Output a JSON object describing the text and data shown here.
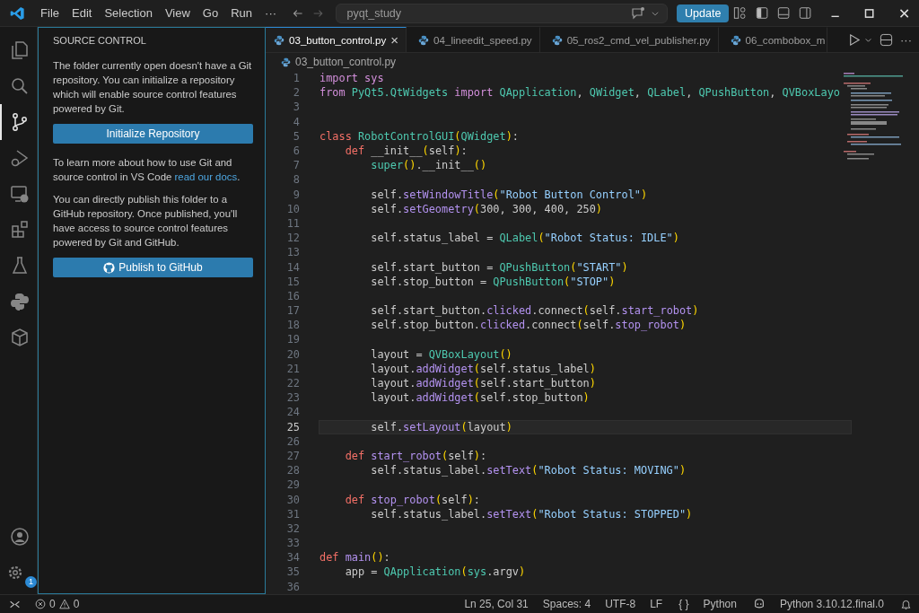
{
  "title_bar": {
    "menus": [
      "File",
      "Edit",
      "Selection",
      "View",
      "Go",
      "Run"
    ],
    "more": "···",
    "search": {
      "value": "pyqt_study"
    },
    "update_button": "Update"
  },
  "activity_bar": {
    "items": [
      {
        "kind": "files",
        "selected": false
      },
      {
        "kind": "search",
        "selected": false
      },
      {
        "kind": "scm",
        "selected": true
      },
      {
        "kind": "debug",
        "selected": false
      },
      {
        "kind": "remote",
        "selected": false
      },
      {
        "kind": "extensions",
        "selected": false
      },
      {
        "kind": "testing",
        "selected": false
      },
      {
        "kind": "python",
        "selected": false
      },
      {
        "kind": "containers",
        "selected": false
      }
    ],
    "settings_badge": "1"
  },
  "sidebar": {
    "title": "SOURCE CONTROL",
    "intro": "The folder currently open doesn't have a Git repository. You can initialize a repository which will enable source control features powered by Git.",
    "init_button": "Initialize Repository",
    "learn": {
      "before": "To learn more about how to use Git and source control in VS Code ",
      "link": "read our docs",
      "after": "."
    },
    "publish_text": "You can directly publish this folder to a GitHub repository. Once published, you'll have access to source control features powered by Git and GitHub.",
    "publish_button": "Publish to GitHub"
  },
  "tabs": [
    {
      "label": "03_button_control.py",
      "selected": true,
      "close": "×"
    },
    {
      "label": "04_lineedit_speed.py",
      "selected": false
    },
    {
      "label": "05_ros2_cmd_vel_publisher.py",
      "selected": false
    },
    {
      "label": "06_combobox_m",
      "selected": false
    }
  ],
  "tab_actions_more": "···",
  "breadcrumb": "03_button_control.py",
  "code": [
    {
      "number": "1",
      "current": false,
      "tokens": [
        {
          "kind": "kw",
          "text": "import"
        },
        {
          "kind": "kw",
          "text": " sys"
        }
      ]
    },
    {
      "number": "2",
      "current": false,
      "tokens": [
        {
          "kind": "kw",
          "text": "from"
        },
        {
          "kind": "cls",
          "text": " PyQt5.QtWidgets"
        },
        {
          "kind": "kw",
          "text": " import"
        },
        {
          "kind": "cls",
          "text": " QApplication"
        },
        {
          "kind": "t",
          "text": ", "
        },
        {
          "kind": "cls",
          "text": "QWidget"
        },
        {
          "kind": "t",
          "text": ", "
        },
        {
          "kind": "cls",
          "text": "QLabel"
        },
        {
          "kind": "t",
          "text": ", "
        },
        {
          "kind": "cls",
          "text": "QPushButton"
        },
        {
          "kind": "t",
          "text": ", "
        },
        {
          "kind": "cls",
          "text": "QVBoxLayo"
        }
      ]
    },
    {
      "number": "3",
      "current": false
    },
    {
      "number": "4",
      "current": false
    },
    {
      "number": "5",
      "current": false,
      "tokens": [
        {
          "kind": "def",
          "text": "class"
        },
        {
          "kind": "cls",
          "text": " RobotControlGUI"
        },
        {
          "kind": "p",
          "text": "("
        },
        {
          "kind": "cls",
          "text": "QWidget"
        },
        {
          "kind": "p",
          "text": ")"
        },
        {
          "kind": "t",
          "text": ":"
        }
      ]
    },
    {
      "number": "6",
      "current": false,
      "tokens": [
        {
          "kind": "def",
          "text": "    def"
        },
        {
          "kind": "t",
          "text": " __init__"
        },
        {
          "kind": "p",
          "text": "("
        },
        {
          "kind": "t",
          "text": "self"
        },
        {
          "kind": "p",
          "text": ")"
        },
        {
          "kind": "t",
          "text": ":"
        }
      ]
    },
    {
      "number": "7",
      "current": false,
      "tokens": [
        {
          "kind": "cls",
          "text": "        super"
        },
        {
          "kind": "p",
          "text": "()"
        },
        {
          "kind": "t",
          "text": ".__init__"
        },
        {
          "kind": "p",
          "text": "()"
        }
      ]
    },
    {
      "number": "8",
      "current": false
    },
    {
      "number": "9",
      "current": false,
      "tokens": [
        {
          "kind": "t",
          "text": "        self."
        },
        {
          "kind": "fn",
          "text": "setWindowTitle"
        },
        {
          "kind": "p",
          "text": "("
        },
        {
          "kind": "str",
          "text": "\"Robot Button Control\""
        },
        {
          "kind": "p",
          "text": ")"
        }
      ]
    },
    {
      "number": "10",
      "current": false,
      "tokens": [
        {
          "kind": "t",
          "text": "        self."
        },
        {
          "kind": "fn",
          "text": "setGeometry"
        },
        {
          "kind": "p",
          "text": "("
        },
        {
          "kind": "t",
          "text": "300, 300, 400, 250"
        },
        {
          "kind": "p",
          "text": ")"
        }
      ]
    },
    {
      "number": "11",
      "current": false
    },
    {
      "number": "12",
      "current": false,
      "tokens": [
        {
          "kind": "t",
          "text": "        self.status_label = "
        },
        {
          "kind": "cls",
          "text": "QLabel"
        },
        {
          "kind": "p",
          "text": "("
        },
        {
          "kind": "str",
          "text": "\"Robot Status: IDLE\""
        },
        {
          "kind": "p",
          "text": ")"
        }
      ]
    },
    {
      "number": "13",
      "current": false
    },
    {
      "number": "14",
      "current": false,
      "tokens": [
        {
          "kind": "t",
          "text": "        self.start_button = "
        },
        {
          "kind": "cls",
          "text": "QPushButton"
        },
        {
          "kind": "p",
          "text": "("
        },
        {
          "kind": "str",
          "text": "\"START\""
        },
        {
          "kind": "p",
          "text": ")"
        }
      ]
    },
    {
      "number": "15",
      "current": false,
      "tokens": [
        {
          "kind": "t",
          "text": "        self.stop_button = "
        },
        {
          "kind": "cls",
          "text": "QPushButton"
        },
        {
          "kind": "p",
          "text": "("
        },
        {
          "kind": "str",
          "text": "\"STOP\""
        },
        {
          "kind": "p",
          "text": ")"
        }
      ]
    },
    {
      "number": "16",
      "current": false
    },
    {
      "number": "17",
      "current": false,
      "tokens": [
        {
          "kind": "t",
          "text": "        self.start_button."
        },
        {
          "kind": "fn",
          "text": "clicked"
        },
        {
          "kind": "t",
          "text": ".connect"
        },
        {
          "kind": "p",
          "text": "("
        },
        {
          "kind": "t",
          "text": "self."
        },
        {
          "kind": "fn",
          "text": "start_robot"
        },
        {
          "kind": "p",
          "text": ")"
        }
      ]
    },
    {
      "number": "18",
      "current": false,
      "tokens": [
        {
          "kind": "t",
          "text": "        self.stop_button."
        },
        {
          "kind": "fn",
          "text": "clicked"
        },
        {
          "kind": "t",
          "text": ".connect"
        },
        {
          "kind": "p",
          "text": "("
        },
        {
          "kind": "t",
          "text": "self."
        },
        {
          "kind": "fn",
          "text": "stop_robot"
        },
        {
          "kind": "p",
          "text": ")"
        }
      ]
    },
    {
      "number": "19",
      "current": false
    },
    {
      "number": "20",
      "current": false,
      "tokens": [
        {
          "kind": "t",
          "text": "        layout = "
        },
        {
          "kind": "cls",
          "text": "QVBoxLayout"
        },
        {
          "kind": "p",
          "text": "()"
        }
      ]
    },
    {
      "number": "21",
      "current": false,
      "tokens": [
        {
          "kind": "t",
          "text": "        layout."
        },
        {
          "kind": "fn",
          "text": "addWidget"
        },
        {
          "kind": "p",
          "text": "("
        },
        {
          "kind": "t",
          "text": "self.status_label"
        },
        {
          "kind": "p",
          "text": ")"
        }
      ]
    },
    {
      "number": "22",
      "current": false,
      "tokens": [
        {
          "kind": "t",
          "text": "        layout."
        },
        {
          "kind": "fn",
          "text": "addWidget"
        },
        {
          "kind": "p",
          "text": "("
        },
        {
          "kind": "t",
          "text": "self.start_button"
        },
        {
          "kind": "p",
          "text": ")"
        }
      ]
    },
    {
      "number": "23",
      "current": false,
      "tokens": [
        {
          "kind": "t",
          "text": "        layout."
        },
        {
          "kind": "fn",
          "text": "addWidget"
        },
        {
          "kind": "p",
          "text": "("
        },
        {
          "kind": "t",
          "text": "self.stop_button"
        },
        {
          "kind": "p",
          "text": ")"
        }
      ]
    },
    {
      "number": "24",
      "current": false
    },
    {
      "number": "25",
      "current": true,
      "tokens": [
        {
          "kind": "t",
          "text": "        self."
        },
        {
          "kind": "fn",
          "text": "setLayout"
        },
        {
          "kind": "p",
          "text": "("
        },
        {
          "kind": "t",
          "text": "layout"
        },
        {
          "kind": "p",
          "text": ")"
        }
      ]
    },
    {
      "number": "26",
      "current": false
    },
    {
      "number": "27",
      "current": false,
      "tokens": [
        {
          "kind": "def",
          "text": "    def"
        },
        {
          "kind": "fn",
          "text": " start_robot"
        },
        {
          "kind": "p",
          "text": "("
        },
        {
          "kind": "t",
          "text": "self"
        },
        {
          "kind": "p",
          "text": ")"
        },
        {
          "kind": "t",
          "text": ":"
        }
      ]
    },
    {
      "number": "28",
      "current": false,
      "tokens": [
        {
          "kind": "t",
          "text": "        self.status_label."
        },
        {
          "kind": "fn",
          "text": "setText"
        },
        {
          "kind": "p",
          "text": "("
        },
        {
          "kind": "str",
          "text": "\"Robot Status: MOVING\""
        },
        {
          "kind": "p",
          "text": ")"
        }
      ]
    },
    {
      "number": "29",
      "current": false
    },
    {
      "number": "30",
      "current": false,
      "tokens": [
        {
          "kind": "def",
          "text": "    def"
        },
        {
          "kind": "fn",
          "text": " stop_robot"
        },
        {
          "kind": "p",
          "text": "("
        },
        {
          "kind": "t",
          "text": "self"
        },
        {
          "kind": "p",
          "text": ")"
        },
        {
          "kind": "t",
          "text": ":"
        }
      ]
    },
    {
      "number": "31",
      "current": false,
      "tokens": [
        {
          "kind": "t",
          "text": "        self.status_label."
        },
        {
          "kind": "fn",
          "text": "setText"
        },
        {
          "kind": "p",
          "text": "("
        },
        {
          "kind": "str",
          "text": "\"Robot Status: STOPPED\""
        },
        {
          "kind": "p",
          "text": ")"
        }
      ]
    },
    {
      "number": "32",
      "current": false
    },
    {
      "number": "33",
      "current": false
    },
    {
      "number": "34",
      "current": false,
      "tokens": [
        {
          "kind": "def",
          "text": "def"
        },
        {
          "kind": "fn",
          "text": " main"
        },
        {
          "kind": "p",
          "text": "()"
        },
        {
          "kind": "t",
          "text": ":"
        }
      ]
    },
    {
      "number": "35",
      "current": false,
      "tokens": [
        {
          "kind": "t",
          "text": "    app = "
        },
        {
          "kind": "cls",
          "text": "QApplication"
        },
        {
          "kind": "p",
          "text": "("
        },
        {
          "kind": "cls",
          "text": "sys"
        },
        {
          "kind": "t",
          "text": ".argv"
        },
        {
          "kind": "p",
          "text": ")"
        }
      ]
    },
    {
      "number": "36",
      "current": false
    }
  ],
  "status_bar": {
    "errors": "0",
    "warnings": "0",
    "position": "Ln 25, Col 31",
    "spaces": "Spaces: 4",
    "encoding": "UTF-8",
    "eol": "LF",
    "language_braces": "{ }",
    "language": "Python",
    "interpreter": "Python 3.10.12.final.0"
  }
}
